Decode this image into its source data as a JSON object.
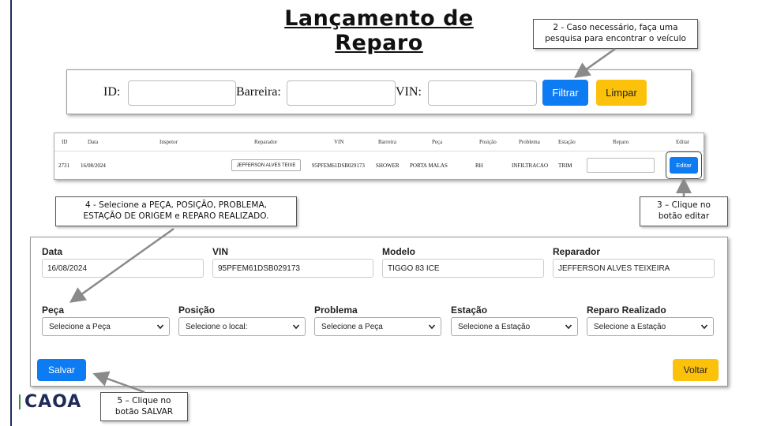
{
  "title": "Lançamento de Reparo",
  "callouts": {
    "step2": "2 - Caso necessário, faça uma pesquisa para encontrar o veículo",
    "step3_line1": "3 – Clique no",
    "step3_line2": "botão editar",
    "step4_line1": "4 - Selecione a PEÇA, POSIÇÃO, PROBLEMA,",
    "step4_line2": "ESTAÇÃO DE ORIGEM e REPARO REALIZADO.",
    "step5_line1": "5 – Clique no",
    "step5_line2": "botão SALVAR"
  },
  "filter": {
    "id_label": "ID:",
    "barreira_label": "Barreira:",
    "vin_label": "VIN:",
    "filtrar_label": "Filtrar",
    "limpar_label": "Limpar"
  },
  "table": {
    "headers": {
      "id": "ID",
      "data": "Data",
      "inspetor": "Inspetor",
      "reparador": "Reparador",
      "vin": "VIN",
      "barreira": "Barreira",
      "peca": "Peça",
      "posicao": "Posição",
      "problema": "Problema",
      "estacao": "Estação",
      "reparo": "Reparo",
      "editar": "Editar"
    },
    "row": {
      "id": "2731",
      "data": "16/08/2024",
      "reparador": "JEFFERSON ALVES TEIXE",
      "vin": "95PFEM61DSB029173",
      "barreira": "SHOWER",
      "peca": "PORTA MALAS",
      "posicao": "RH",
      "problema": "INFILTRACAO",
      "estacao": "TRIM",
      "editar_label": "Editar"
    }
  },
  "form": {
    "data_label": "Data",
    "data_value": "16/08/2024",
    "vin_label": "VIN",
    "vin_value": "95PFEM61DSB029173",
    "modelo_label": "Modelo",
    "modelo_value": "TIGGO 83 ICE",
    "reparador_label": "Reparador",
    "reparador_value": "JEFFERSON ALVES TEIXEIRA",
    "peca_label": "Peça",
    "peca_select": "Selecione a Peça",
    "posicao_label": "Posição",
    "posicao_select": "Selecione o local:",
    "problema_label": "Problema",
    "problema_select": "Selecione a Peça",
    "estacao_label": "Estação",
    "estacao_select": "Selecione a Estação",
    "reparo_label": "Reparo Realizado",
    "reparo_select": "Selecione a Estação",
    "salvar_label": "Salvar",
    "voltar_label": "Voltar"
  },
  "logo_text": "CAOA",
  "colors": {
    "primary_blue": "#0d7bf2",
    "warning_yellow": "#fcc10a",
    "brand_navy": "#1f2a5a"
  }
}
